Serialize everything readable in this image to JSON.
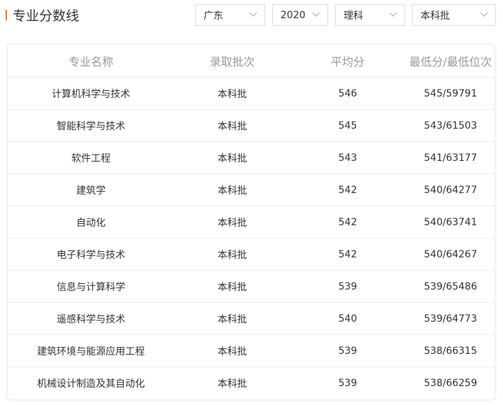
{
  "page": {
    "title": "专业分数线",
    "accent_color": "#e87722"
  },
  "filters": {
    "province": "广东",
    "year": "2020",
    "subject": "理科",
    "batch": "本科批"
  },
  "table": {
    "headers": [
      "专业名称",
      "录取批次",
      "平均分",
      "最低分/最低位次"
    ],
    "rows": [
      {
        "major": "计算机科学与技术",
        "batch": "本科批",
        "avg": "546",
        "min": "545/59791"
      },
      {
        "major": "智能科学与技术",
        "batch": "本科批",
        "avg": "545",
        "min": "543/61503"
      },
      {
        "major": "软件工程",
        "batch": "本科批",
        "avg": "543",
        "min": "541/63177"
      },
      {
        "major": "建筑学",
        "batch": "本科批",
        "avg": "542",
        "min": "540/64277"
      },
      {
        "major": "自动化",
        "batch": "本科批",
        "avg": "542",
        "min": "540/63741"
      },
      {
        "major": "电子科学与技术",
        "batch": "本科批",
        "avg": "542",
        "min": "540/64267"
      },
      {
        "major": "信息与计算科学",
        "batch": "本科批",
        "avg": "539",
        "min": "539/65486"
      },
      {
        "major": "遥感科学与技术",
        "batch": "本科批",
        "avg": "540",
        "min": "539/64773"
      },
      {
        "major": "建筑环境与能源应用工程",
        "batch": "本科批",
        "avg": "539",
        "min": "538/66315"
      },
      {
        "major": "机械设计制造及其自动化",
        "batch": "本科批",
        "avg": "539",
        "min": "538/66259"
      }
    ]
  },
  "icons": {
    "dropdown": "chevron-down-icon"
  }
}
